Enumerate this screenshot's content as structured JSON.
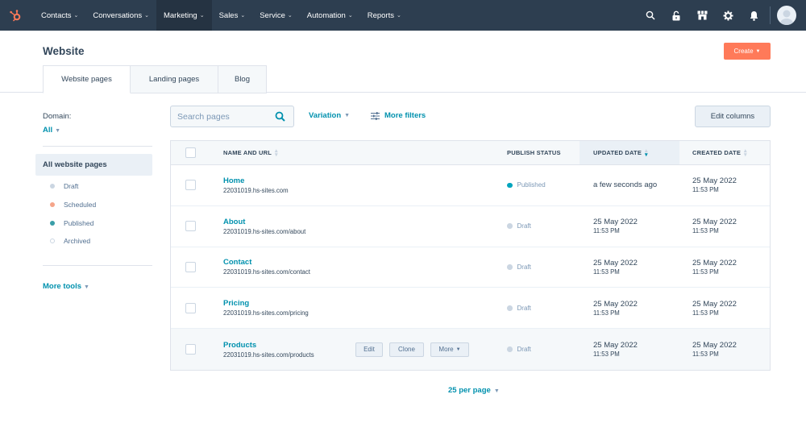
{
  "topnav": {
    "logo": "hubspot-sprocket-icon",
    "items": [
      {
        "label": "Contacts",
        "active": false
      },
      {
        "label": "Conversations",
        "active": false
      },
      {
        "label": "Marketing",
        "active": true
      },
      {
        "label": "Sales",
        "active": false
      },
      {
        "label": "Service",
        "active": false
      },
      {
        "label": "Automation",
        "active": false
      },
      {
        "label": "Reports",
        "active": false
      }
    ],
    "chevron": "⌄",
    "right_icons": [
      "search-icon",
      "unlock-icon",
      "marketplace-icon",
      "gear-icon",
      "bell-icon"
    ],
    "avatar": "user-avatar"
  },
  "header": {
    "title": "Website",
    "create_label": "Create",
    "caret": "▼",
    "tabs": [
      {
        "label": "Website pages",
        "active": true
      },
      {
        "label": "Landing pages",
        "active": false
      },
      {
        "label": "Blog",
        "active": false
      }
    ]
  },
  "sidebar": {
    "domain_label": "Domain:",
    "domain_value": "All",
    "all_label": "All website pages",
    "statuses": [
      {
        "label": "Draft",
        "color": "#cbd6e2"
      },
      {
        "label": "Scheduled",
        "color": "#f5c26b"
      },
      {
        "label": "Published",
        "color": "#00a4bd"
      },
      {
        "label": "Archived",
        "color": "#ffffff"
      }
    ],
    "more_tools": "More tools"
  },
  "toolbar": {
    "search_placeholder": "Search pages",
    "variation_label": "Variation",
    "more_filters_label": "More filters",
    "edit_columns_label": "Edit columns"
  },
  "table": {
    "columns": {
      "name": "NAME AND URL",
      "status": "PUBLISH STATUS",
      "updated": "UPDATED DATE",
      "created": "CREATED DATE"
    },
    "sorted_by": "updated",
    "row_actions": {
      "edit": "Edit",
      "clone": "Clone",
      "more": "More"
    },
    "rows": [
      {
        "name": "Home",
        "url": "22031019.hs-sites.com",
        "status": "Published",
        "status_color": "#00a4bd",
        "updated_date": "a few seconds ago",
        "updated_time": "",
        "created_date": "25 May 2022",
        "created_time": "11:53 PM"
      },
      {
        "name": "About",
        "url": "22031019.hs-sites.com/about",
        "status": "Draft",
        "status_color": "#cbd6e2",
        "updated_date": "25 May 2022",
        "updated_time": "11:53 PM",
        "created_date": "25 May 2022",
        "created_time": "11:53 PM"
      },
      {
        "name": "Contact",
        "url": "22031019.hs-sites.com/contact",
        "status": "Draft",
        "status_color": "#cbd6e2",
        "updated_date": "25 May 2022",
        "updated_time": "11:53 PM",
        "created_date": "25 May 2022",
        "created_time": "11:53 PM"
      },
      {
        "name": "Pricing",
        "url": "22031019.hs-sites.com/pricing",
        "status": "Draft",
        "status_color": "#cbd6e2",
        "updated_date": "25 May 2022",
        "updated_time": "11:53 PM",
        "created_date": "25 May 2022",
        "created_time": "11:53 PM"
      },
      {
        "name": "Products",
        "url": "22031019.hs-sites.com/products",
        "status": "Draft",
        "status_color": "#cbd6e2",
        "updated_date": "25 May 2022",
        "updated_time": "11:53 PM",
        "created_date": "25 May 2022",
        "created_time": "11:53 PM",
        "hovered": true
      }
    ]
  },
  "pagination": {
    "per_page_label": "25 per page"
  },
  "colors": {
    "nav_bg": "#2d3e50",
    "accent": "#0091ae",
    "create": "#ff7a59"
  }
}
